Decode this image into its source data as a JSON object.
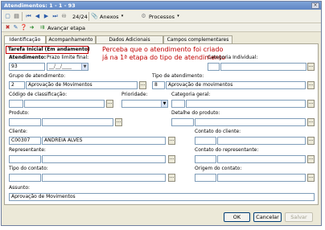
{
  "window": {
    "title": "Atendimentos: 1 - 1 - 93",
    "close": "×"
  },
  "toolbar": {
    "counter": "24/24",
    "annexes": "Anexos",
    "processes": "Processos",
    "advance_step": "Avançar etapa"
  },
  "tabs": [
    "Identificação",
    "Acompanhamento",
    "Dados Adicionais",
    "Campos complementares"
  ],
  "status": "Tarefa Inicial (Em andamento)",
  "annotation": "Perceba que o atendimento foi criado já na 1ª etapa do tipo de atendimento",
  "form": {
    "atendimento_label": "Atendimento:",
    "atendimento_value": "93",
    "prazo_label": "Prazo limite final:",
    "prazo_value": "__/__/____",
    "categoria_individual_label": "Categoria Individual:",
    "grupo_label": "Grupo de atendimento:",
    "grupo_code": "2",
    "grupo_value": "Aprovação de Movimentos",
    "tipo_label": "Tipo de atendimento:",
    "tipo_code": "8",
    "tipo_value": "Aprovação de movimentos",
    "codigo_label": "Código de classificação:",
    "prioridade_label": "Prioridade:",
    "categoria_geral_label": "Categoria geral:",
    "produto_label": "Produto:",
    "detalhe_label": "Detalhe do produto:",
    "cliente_label": "Cliente:",
    "cliente_code": "C00307",
    "cliente_value": "ANDRÉIA ALVES",
    "contato_cliente_label": "Contato do cliente:",
    "representante_label": "Representante:",
    "contato_rep_label": "Contato do representante:",
    "tipo_contato_label": "Tipo do contato:",
    "origem_label": "Origem do contato:",
    "assunto_label": "Assunto:",
    "assunto_value": "Aprovação de Movimentos",
    "lookup": "..."
  },
  "buttons": {
    "ok": "OK",
    "cancel": "Cancelar",
    "save": "Salvar"
  }
}
